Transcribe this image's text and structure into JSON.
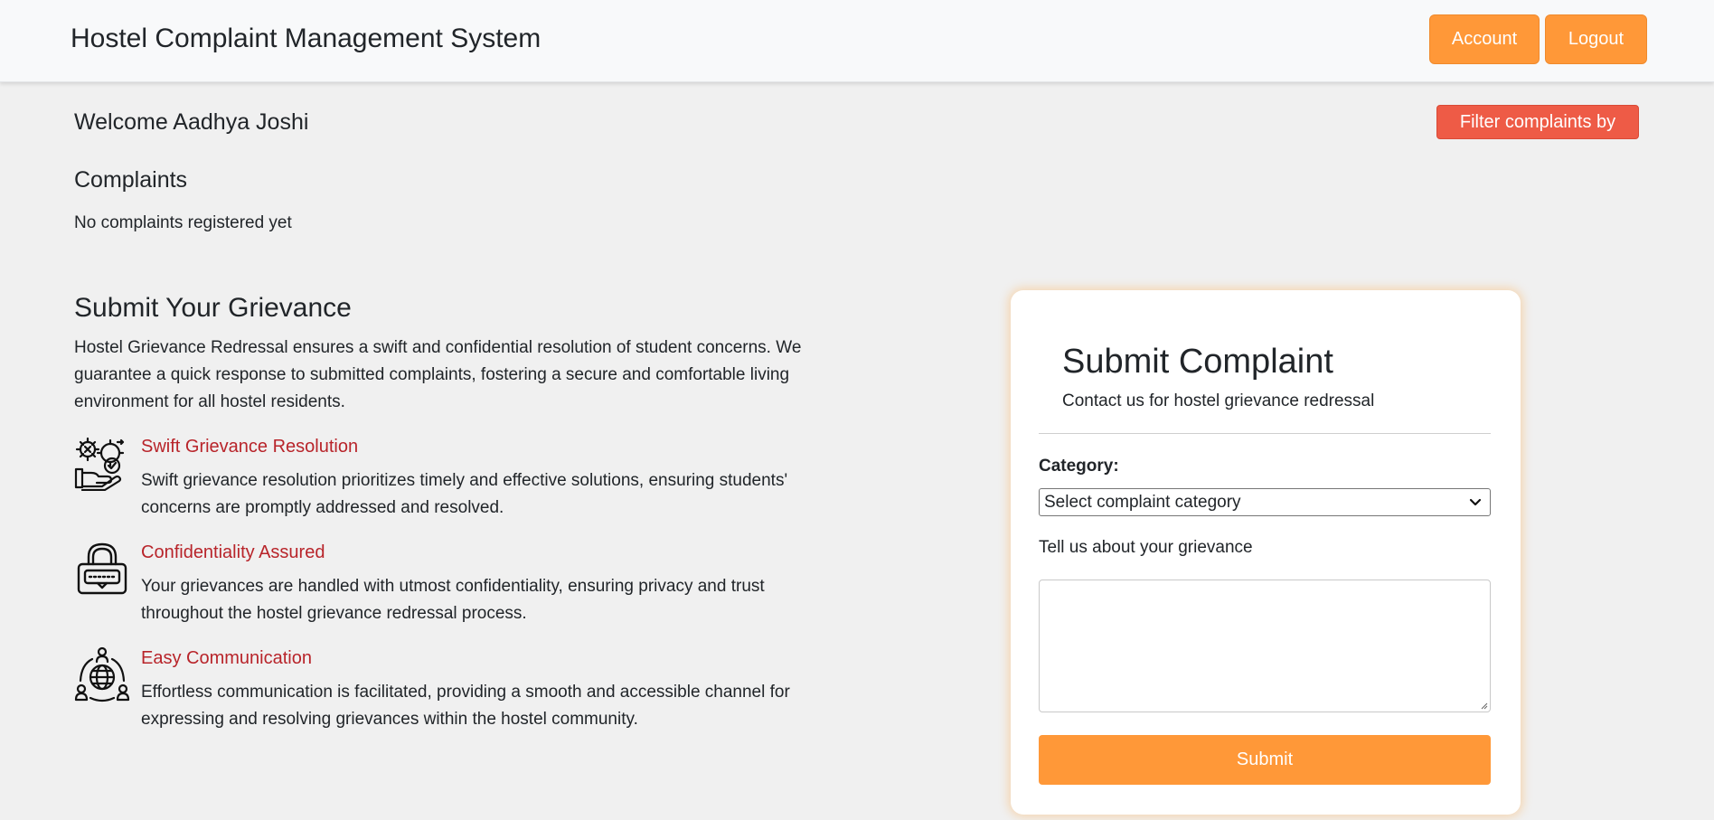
{
  "navbar": {
    "brand": "Hostel Complaint Management System",
    "account_label": "Account",
    "logout_label": "Logout"
  },
  "welcome": "Welcome Aadhya Joshi",
  "filter_label": "Filter complaints by",
  "complaints": {
    "heading": "Complaints",
    "empty_text": "No complaints registered yet"
  },
  "grievance": {
    "heading": "Submit Your Grievance",
    "description": "Hostel Grievance Redressal ensures a swift and confidential resolution of student concerns. We guarantee a quick response to submitted complaints, fostering a secure and comfortable living environment for all hostel residents.",
    "features": [
      {
        "icon": "gear-hand-check-icon",
        "title": "Swift Grievance Resolution",
        "text": "Swift grievance resolution prioritizes timely and effective solutions, ensuring students' concerns are promptly addressed and resolved."
      },
      {
        "icon": "padlock-icon",
        "title": "Confidentiality Assured",
        "text": "Your grievances are handled with utmost confidentiality, ensuring privacy and trust throughout the hostel grievance redressal process."
      },
      {
        "icon": "globe-people-icon",
        "title": "Easy Communication",
        "text": "Effortless communication is facilitated, providing a smooth and accessible channel for expressing and resolving grievances within the hostel community."
      }
    ]
  },
  "form": {
    "title": "Submit Complaint",
    "subtitle": "Contact us for hostel grievance redressal",
    "category_label": "Category:",
    "category_value": "Select complaint category",
    "textarea_label": "Tell us about your grievance",
    "textarea_value": "",
    "submit_label": "Submit"
  },
  "colors": {
    "accent_orange": "#ff9838",
    "filter_red": "#ee5b46",
    "feature_title_red": "#b8242a",
    "background": "#f0f0f0"
  }
}
